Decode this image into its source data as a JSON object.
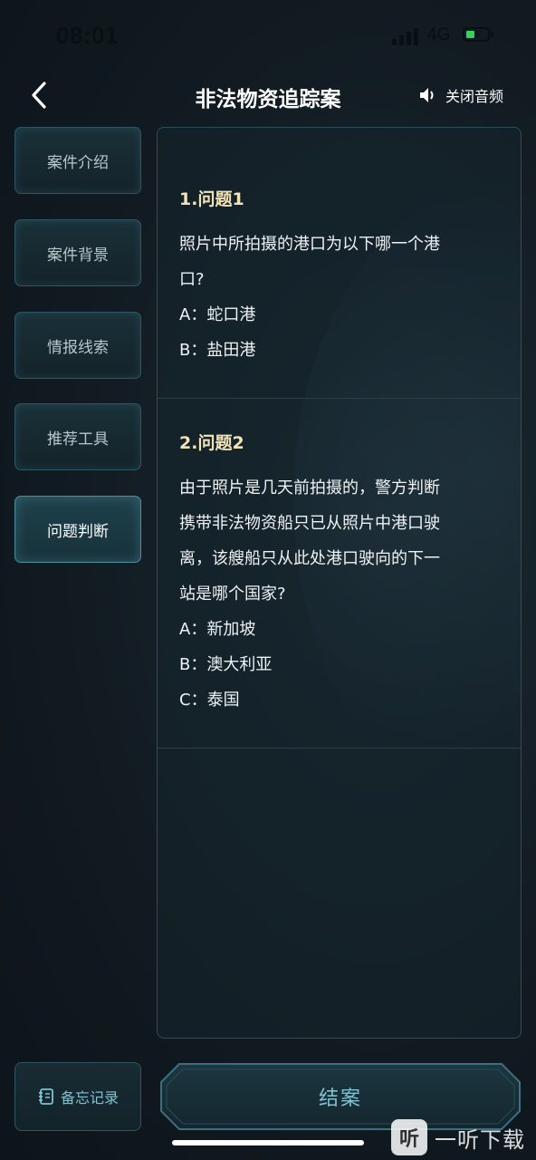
{
  "status_bar": {
    "time": "08:01",
    "network": "4G"
  },
  "nav": {
    "title": "非法物资追踪案",
    "audio_label": "关闭音频"
  },
  "sidebar": {
    "items": [
      {
        "label": "案件介绍"
      },
      {
        "label": "案件背景"
      },
      {
        "label": "情报线索"
      },
      {
        "label": "推荐工具"
      },
      {
        "label": "问题判断",
        "active": true
      }
    ]
  },
  "questions": [
    {
      "title": "1.问题1",
      "lines": [
        "照片中所拍摄的港口为以下哪一个港",
        "口?",
        "A：蛇口港",
        "B：盐田港"
      ]
    },
    {
      "title": "2.问题2",
      "lines": [
        "由于照片是几天前拍摄的，警方判断",
        "携带非法物资船只已从照片中港口驶",
        "离，该艘船只从此处港口驶向的下一",
        "站是哪个国家?",
        "A：新加坡",
        "B：澳大利亚",
        "C：泰国"
      ]
    }
  ],
  "footer": {
    "memo_label": "备忘记录",
    "close_case_label": "结案"
  },
  "watermark": {
    "logo_glyph": "听",
    "text": "一听下载"
  },
  "colors": {
    "accent": "#7ec2d2",
    "question_title": "#f1e3b6",
    "panel_border": "#27505d"
  }
}
